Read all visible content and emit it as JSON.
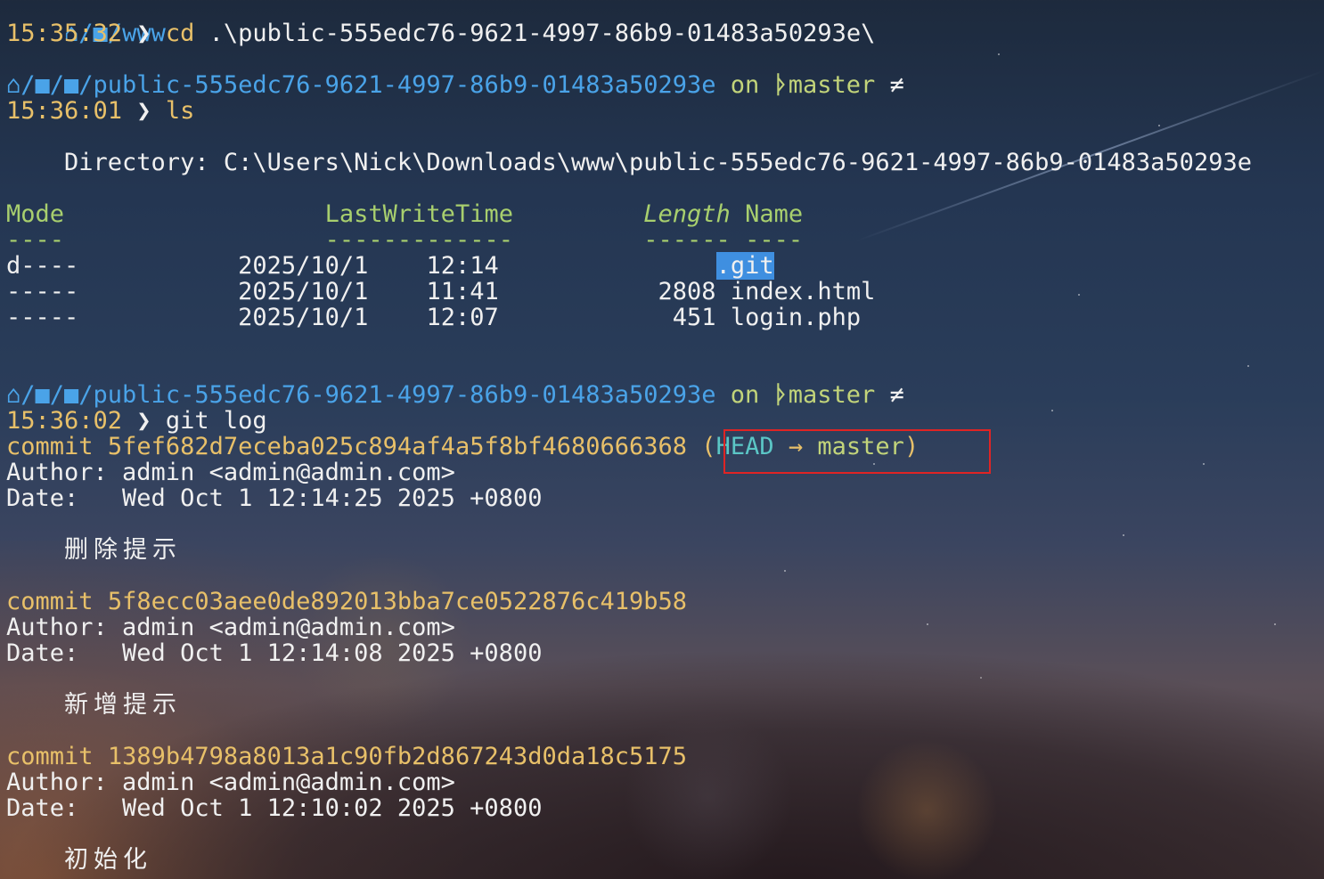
{
  "prompt": {
    "path_first": "/■/www",
    "path_repo": "/■/■/public-555edc76-9621-4997-86b9-01483a50293e",
    "on_label": "on",
    "branch": "master",
    "branch_icon": "git-branch-icon",
    "neq": "≠",
    "chevron": "❯"
  },
  "commands": [
    {
      "time": "15:35:32",
      "cmd": "cd",
      "args": ".\\public-555edc76-9621-4997-86b9-01483a50293e\\"
    },
    {
      "time": "15:36:01",
      "cmd": "ls",
      "args": ""
    },
    {
      "time": "15:36:02",
      "cmd": "git",
      "args": "log"
    }
  ],
  "ls": {
    "directory_label": "    Directory: C:\\Users\\Nick\\Downloads\\www\\public-555edc76-9621-4997-86b9-01483a50293e",
    "headers": {
      "mode": "Mode",
      "lwt": "LastWriteTime",
      "length": "Length",
      "name": "Name"
    },
    "underlines": {
      "mode": "----",
      "lwt": "-------------",
      "length": "------",
      "name": "----"
    },
    "rows": [
      {
        "mode": "d----",
        "date": "2025/10/1",
        "time": "12:14",
        "length": "",
        "name": ".git"
      },
      {
        "mode": "-----",
        "date": "2025/10/1",
        "time": "11:41",
        "length": "2808",
        "name": "index.html"
      },
      {
        "mode": "-----",
        "date": "2025/10/1",
        "time": "12:07",
        "length": "451",
        "name": "login.php"
      }
    ]
  },
  "git_log": {
    "commits": [
      {
        "label": "commit",
        "hash": "5fef682d7eceba025c894af4a5f8bf4680666368",
        "ref_head": "HEAD",
        "ref_arrow": "→",
        "ref_branch": "master",
        "author": "Author: admin <admin@admin.com>",
        "date": "Date:   Wed Oct 1 12:14:25 2025 +0800",
        "message": "删除提示"
      },
      {
        "label": "commit",
        "hash": "5f8ecc03aee0de892013bba7ce0522876c419b58",
        "author": "Author: admin <admin@admin.com>",
        "date": "Date:   Wed Oct 1 12:14:08 2025 +0800",
        "message": "新增提示"
      },
      {
        "label": "commit",
        "hash": "1389b4798a8013a1c90fb2d867243d0da18c5175",
        "author": "Author: admin <admin@admin.com>",
        "date": "Date:   Wed Oct 1 12:10:02 2025 +0800",
        "message": "初始化"
      }
    ]
  },
  "colors": {
    "time": "#e8c069",
    "path": "#4aa3e8",
    "branch": "#c2d47a",
    "header": "#a8cf6e",
    "head_ref": "#5bc6c6",
    "selection": "#3f8fe0",
    "highlight_box": "#e02424"
  }
}
